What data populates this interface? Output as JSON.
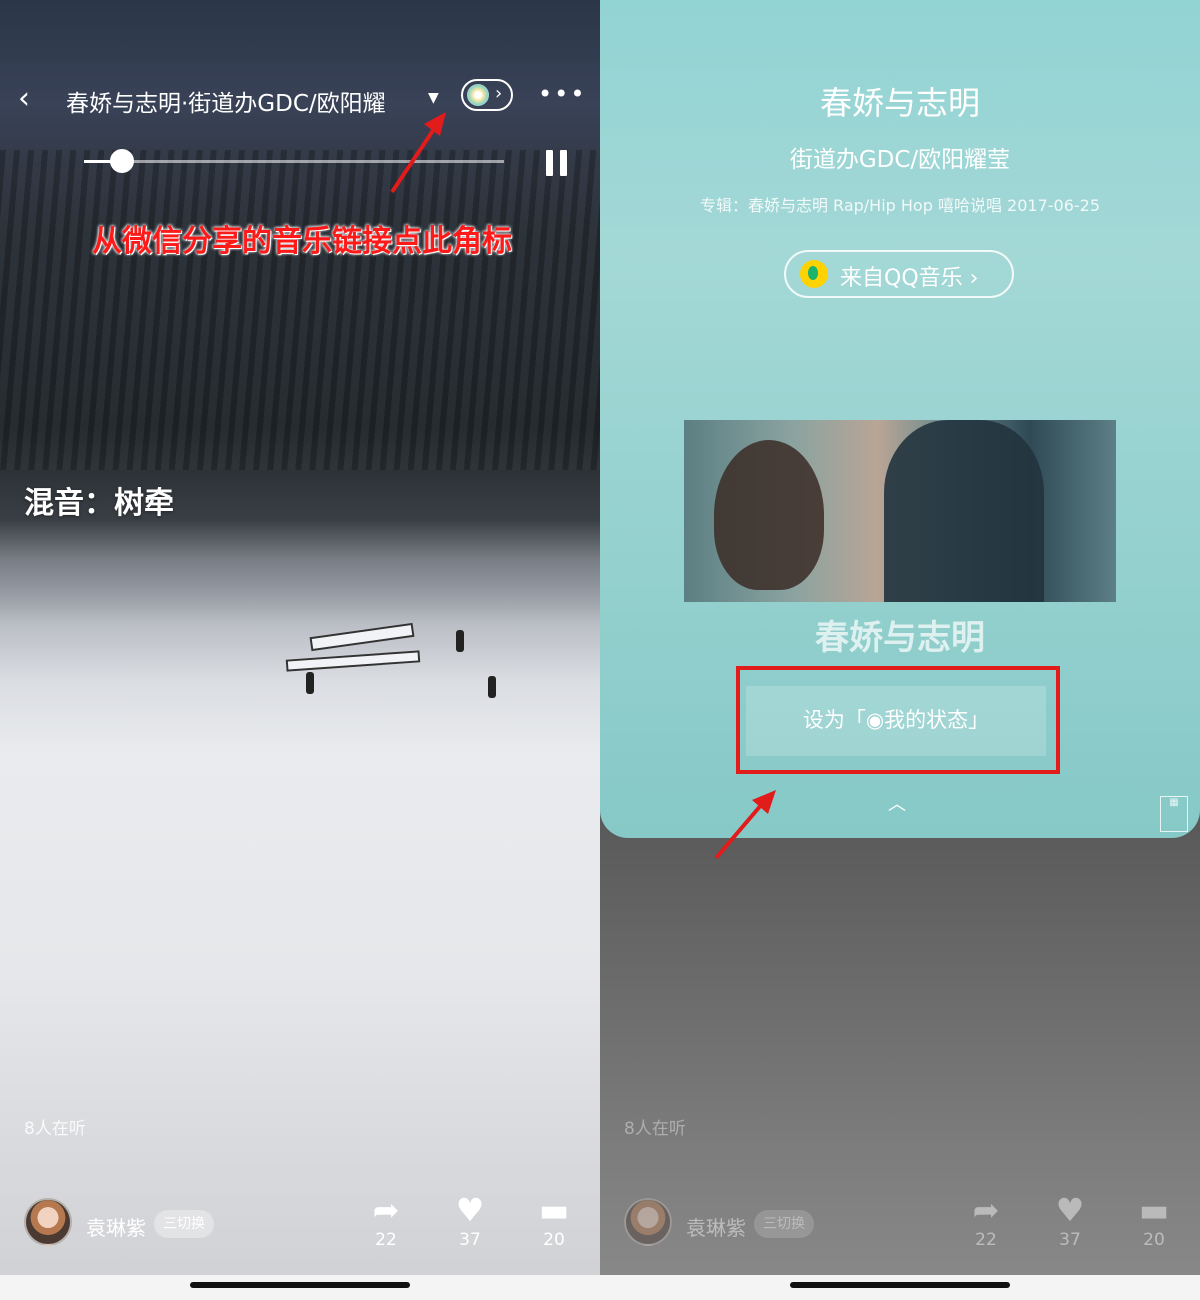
{
  "left": {
    "song_title": "春娇与志明·街道办GDC/欧阳耀",
    "mix_credit": "混音：树牵",
    "annotation": "从微信分享的音乐链接点此角标",
    "listeners": "8人在听",
    "progress": 0.09,
    "user": {
      "name": "袁琳紫",
      "switch_label": "三切换"
    },
    "actions": {
      "share_count": "22",
      "like_count": "37",
      "comment_count": "20"
    }
  },
  "right": {
    "card": {
      "title": "春娇与志明",
      "artist": "街道办GDC/欧阳耀莹",
      "album_info": "专辑：春娇与志明 Rap/Hip Hop 嘻哈说唱 2017-06-25",
      "from_label": "来自QQ音乐 ›",
      "cover_caption": "春娇与志明",
      "set_status_label": "设为「◉我的状态」"
    },
    "listeners": "8人在听",
    "user": {
      "name": "袁琳紫",
      "switch_label": "三切换"
    },
    "actions": {
      "share_count": "22",
      "like_count": "37",
      "comment_count": "20"
    }
  },
  "colors": {
    "annotation_red": "#ff1a1a",
    "card_teal": "#9fd6d4",
    "frame_red": "#e21b1b"
  },
  "icons": [
    "back-icon",
    "dropdown-icon",
    "music-badge-icon",
    "more-icon",
    "pause-icon",
    "share-icon",
    "heart-icon",
    "comment-icon",
    "qq-music-icon",
    "collapse-icon"
  ]
}
